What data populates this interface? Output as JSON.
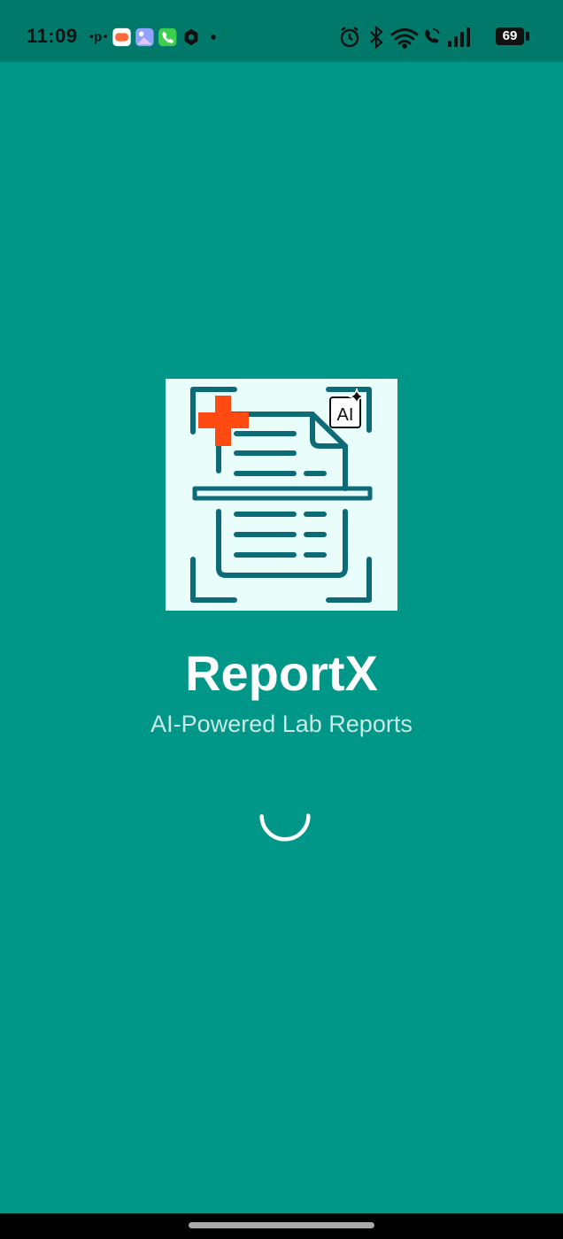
{
  "status_bar": {
    "time": "11:09",
    "battery": "69",
    "left_icons": [
      "p-icon",
      "game-icon",
      "gallery-icon",
      "phone-app-icon",
      "hex-app-icon",
      "dot-icon"
    ],
    "right_icons": [
      "alarm-icon",
      "bluetooth-icon",
      "wifi-icon",
      "wifi-call-icon",
      "signal-icon",
      "battery-icon"
    ]
  },
  "logo": {
    "ai_badge": "AI",
    "icon": "document-scan-icon",
    "colors": {
      "document": "#0d6b78",
      "cross": "#ff4a12",
      "background": "#e9fdfb"
    }
  },
  "splash": {
    "title": "ReportX",
    "subtitle": "AI-Powered Lab Reports"
  },
  "colors": {
    "background": "#009688",
    "status_bar": "#00796b"
  }
}
